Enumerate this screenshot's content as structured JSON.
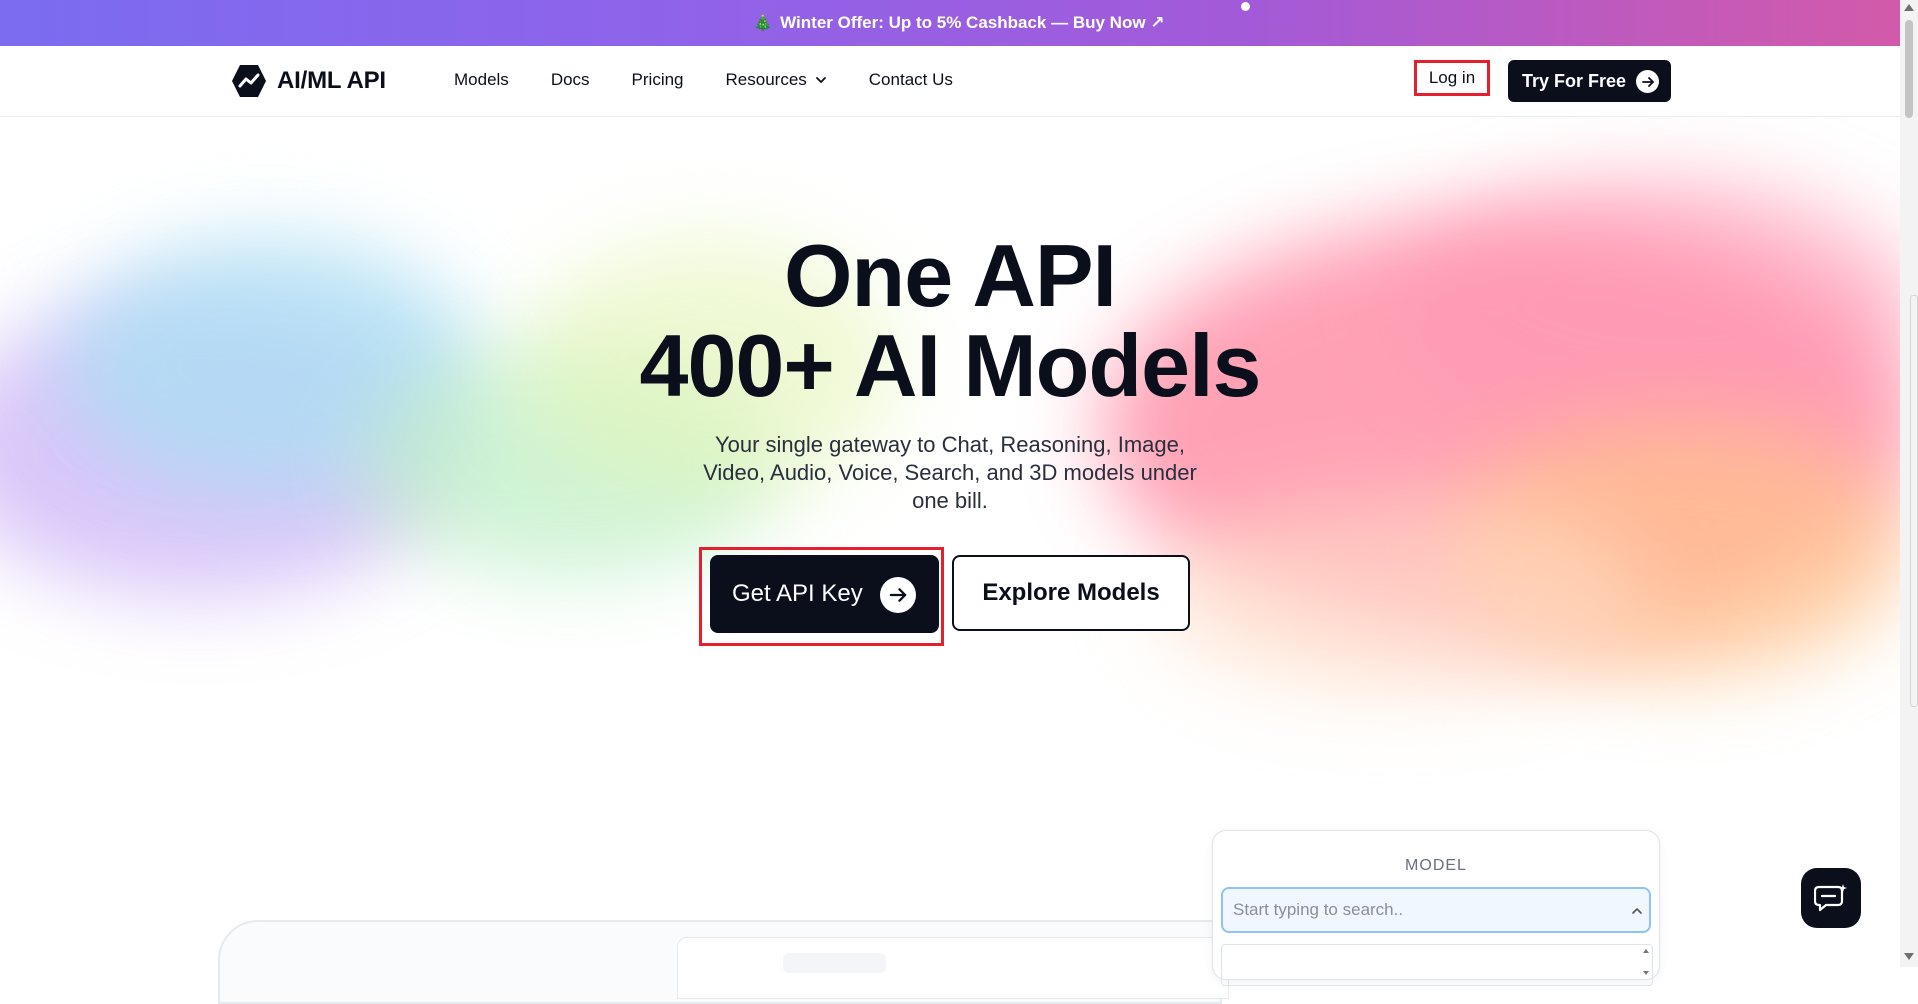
{
  "promo": {
    "icon": "tree-icon",
    "text": "Winter Offer: Up to 5% Cashback — Buy Now ↗"
  },
  "brand": {
    "name": "AI/ML API",
    "icon": "logo-hexagon-icon"
  },
  "nav": {
    "models": "Models",
    "docs": "Docs",
    "pricing": "Pricing",
    "resources": "Resources",
    "contact": "Contact Us"
  },
  "header": {
    "login": "Log in",
    "try": "Try For Free"
  },
  "hero": {
    "line1": "One API",
    "line2": "400+ AI Models",
    "subtitle": "Your single gateway to Chat, Reasoning, Image, Video, Audio, Voice, Search, and 3D models under one bill.",
    "cta_primary": "Get API Key",
    "cta_secondary": "Explore Models"
  },
  "model_panel": {
    "label": "MODEL",
    "placeholder": "Start typing to search.."
  },
  "colors": {
    "accent": "#0b0f1c",
    "highlight": "#e5202e",
    "promo_start": "#7b6cf0",
    "promo_end": "#d45aa8"
  }
}
